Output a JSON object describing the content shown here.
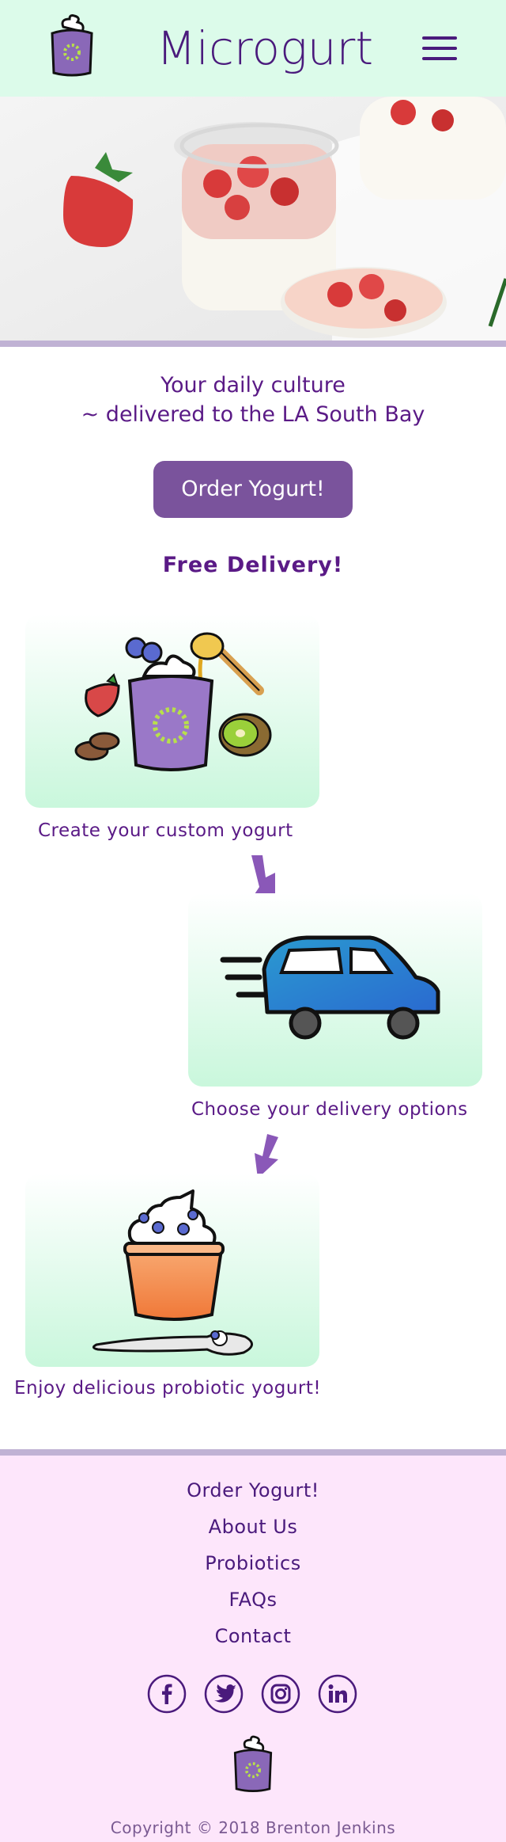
{
  "header": {
    "brand": "Microgurt"
  },
  "hero": {
    "tagline_line1": "Your daily culture",
    "tagline_line2": "~ delivered to the LA South Bay",
    "order_button": "Order Yogurt!",
    "free_delivery": "Free Delivery!"
  },
  "steps": [
    {
      "label": "Create your custom yogurt"
    },
    {
      "label": "Choose your delivery options"
    },
    {
      "label": "Enjoy delicious probiotic yogurt!"
    }
  ],
  "footer": {
    "links": [
      "Order Yogurt!",
      "About Us",
      "Probiotics",
      "FAQs",
      "Contact"
    ],
    "social": [
      "facebook-icon",
      "twitter-icon",
      "instagram-icon",
      "linkedin-icon"
    ],
    "copyright": "Copyright © 2018 Brenton Jenkins"
  },
  "colors": {
    "header_bg": "#dcfbea",
    "brand": "#4a1a7c",
    "button_bg": "#7a539c",
    "footer_bg": "#fde6fb",
    "divider": "#c0b2d4"
  }
}
